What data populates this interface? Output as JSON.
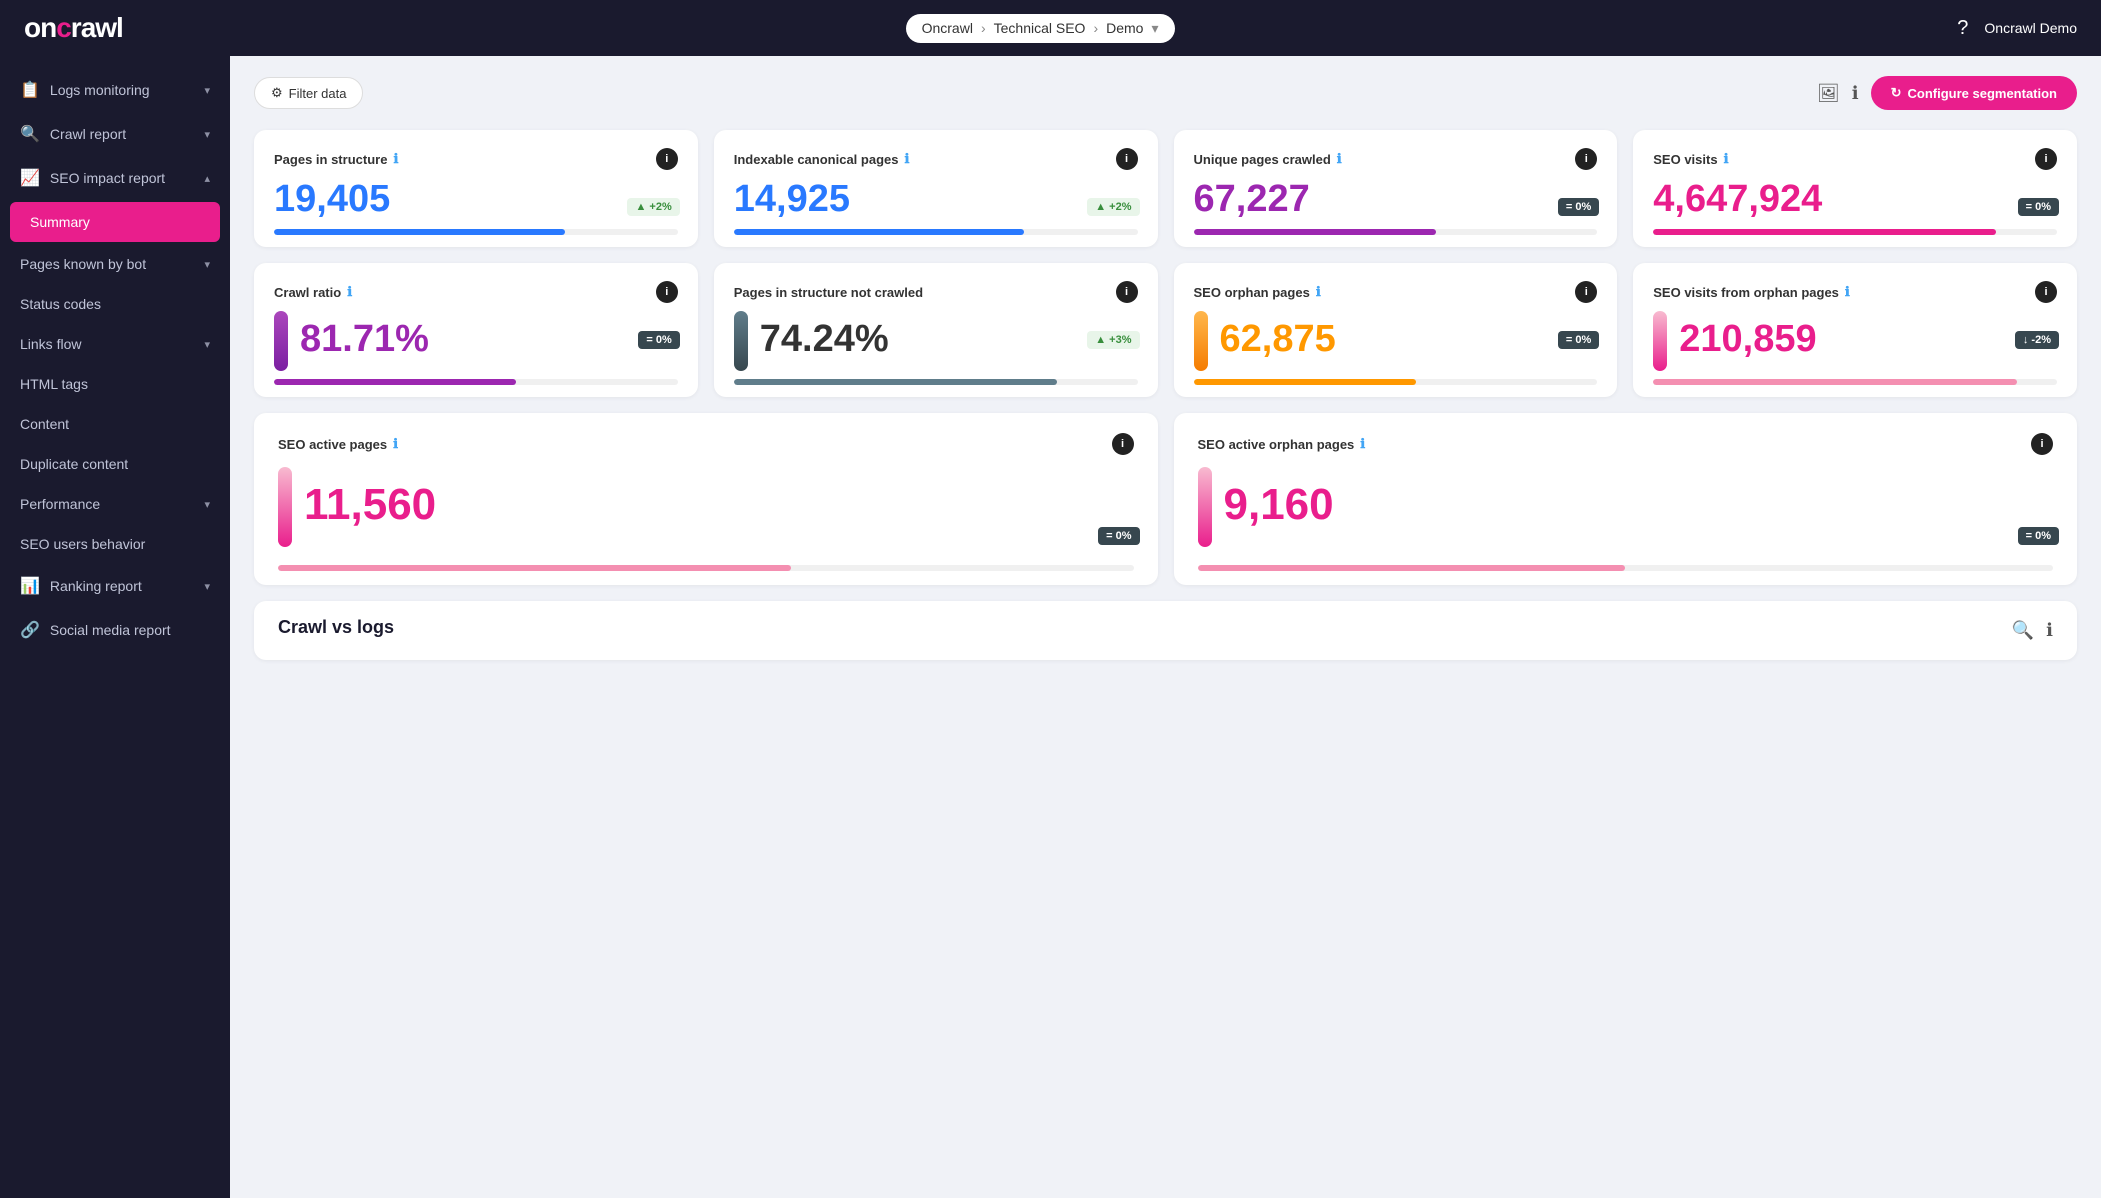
{
  "topnav": {
    "logo": "oncrawl",
    "breadcrumb": [
      "Oncrawl",
      "Technical SEO",
      "Demo"
    ],
    "help_label": "?",
    "user_label": "Oncrawl Demo"
  },
  "sidebar": {
    "items": [
      {
        "id": "logs-monitoring",
        "label": "Logs monitoring",
        "icon": "📋",
        "has_chevron": true
      },
      {
        "id": "crawl-report",
        "label": "Crawl report",
        "icon": "🔍",
        "has_chevron": true
      },
      {
        "id": "seo-impact-report",
        "label": "SEO impact report",
        "icon": "📈",
        "has_chevron": true,
        "expanded": true
      },
      {
        "id": "summary",
        "label": "Summary",
        "active": true
      },
      {
        "id": "pages-known-by-bot",
        "label": "Pages known by bot",
        "has_chevron": true
      },
      {
        "id": "status-codes",
        "label": "Status codes"
      },
      {
        "id": "links-flow",
        "label": "Links flow",
        "has_chevron": true
      },
      {
        "id": "html-tags",
        "label": "HTML tags"
      },
      {
        "id": "content",
        "label": "Content"
      },
      {
        "id": "duplicate-content",
        "label": "Duplicate content"
      },
      {
        "id": "performance",
        "label": "Performance",
        "has_chevron": true
      },
      {
        "id": "seo-users-behavior",
        "label": "SEO users behavior"
      },
      {
        "id": "ranking-report",
        "label": "Ranking report",
        "icon": "📊",
        "has_chevron": true
      },
      {
        "id": "social-media-report",
        "label": "Social media report",
        "icon": "🔗"
      }
    ]
  },
  "toolbar": {
    "filter_label": "Filter data",
    "configure_label": "Configure segmentation"
  },
  "cards": [
    {
      "id": "pages-in-structure",
      "title": "Pages in structure",
      "value": "19,405",
      "color": "blue",
      "badge_type": "up",
      "badge_text": "+2%",
      "bar_class": "pb-blue"
    },
    {
      "id": "indexable-canonical-pages",
      "title": "Indexable canonical pages",
      "value": "14,925",
      "color": "blue",
      "badge_type": "up",
      "badge_text": "+2%",
      "bar_class": "pb-blue"
    },
    {
      "id": "unique-pages-crawled",
      "title": "Unique pages crawled",
      "value": "67,227",
      "color": "purple",
      "badge_type": "neutral",
      "badge_text": "= 0%",
      "bar_class": "pb-purple"
    },
    {
      "id": "seo-visits",
      "title": "SEO visits",
      "value": "4,647,924",
      "color": "pink",
      "badge_type": "neutral",
      "badge_text": "= 0%",
      "bar_class": "pb-pink"
    },
    {
      "id": "crawl-ratio",
      "title": "Crawl ratio",
      "value": "81.71%",
      "color": "purple",
      "badge_type": "neutral",
      "badge_text": "= 0%",
      "bar_class": "pb-purple",
      "has_bar_visual": true,
      "bar_type": "purple"
    },
    {
      "id": "pages-in-structure-not-crawled",
      "title": "Pages in structure not crawled",
      "value": "74.24%",
      "color": "dark",
      "badge_type": "up",
      "badge_text": "+3%",
      "bar_class": "pb-gray",
      "has_bar_visual": true,
      "bar_type": "dark"
    },
    {
      "id": "seo-orphan-pages",
      "title": "SEO orphan pages",
      "value": "62,875",
      "color": "orange",
      "badge_type": "neutral",
      "badge_text": "= 0%",
      "bar_class": "pb-orange",
      "has_bar_visual": true,
      "bar_type": "orange"
    },
    {
      "id": "seo-visits-orphan-pages",
      "title": "SEO visits from orphan pages",
      "value": "210,859",
      "color": "pink",
      "badge_type": "down",
      "badge_text": "↓ -2%",
      "bar_class": "pb-pinklight",
      "has_bar_visual": true,
      "bar_type": "pinklight"
    }
  ],
  "wide_cards": [
    {
      "id": "seo-active-pages",
      "title": "SEO active pages",
      "value": "11,560",
      "color": "pink",
      "badge_type": "neutral",
      "badge_text": "= 0%",
      "bar_class": "pb-pinklight"
    },
    {
      "id": "seo-active-orphan-pages",
      "title": "SEO active orphan pages",
      "value": "9,160",
      "color": "pink",
      "badge_type": "neutral",
      "badge_text": "= 0%",
      "bar_class": "pb-pinklight"
    }
  ],
  "crawl_vs_logs": {
    "title": "Crawl vs logs"
  }
}
